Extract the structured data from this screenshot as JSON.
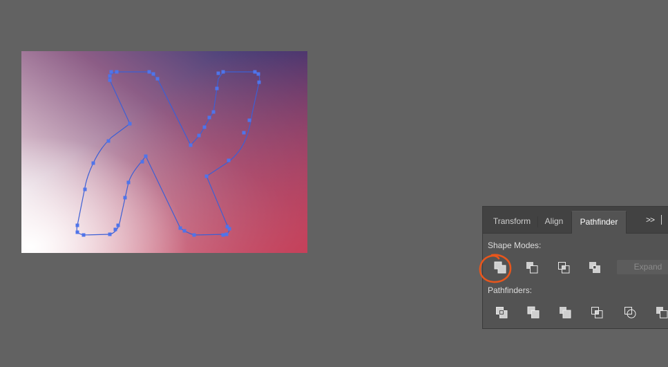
{
  "panel": {
    "tabs": [
      {
        "label": "Transform"
      },
      {
        "label": "Align"
      },
      {
        "label": "Pathfinder",
        "active": true
      }
    ],
    "overflow_label": ">>",
    "shape_modes_label": "Shape Modes:",
    "pathfinders_label": "Pathfinders:",
    "expand_label": "Expand",
    "shape_mode_buttons": [
      "unite-icon",
      "minus-front-icon",
      "intersect-icon",
      "exclude-icon"
    ],
    "pathfinder_buttons": [
      "divide-icon",
      "trim-icon",
      "merge-icon",
      "crop-icon",
      "outline-icon",
      "minus-back-icon"
    ]
  },
  "colors": {
    "background": "#626262",
    "panel": "#535353",
    "path_stroke": "#3d5fd4",
    "anchor": "#4f74ea",
    "highlight": "#e8561c",
    "gradient_white": "#ffffff",
    "gradient_pink": "#c7a4ba",
    "gradient_navy": "#2f3574",
    "gradient_red": "#c83d56"
  },
  "canvas": {
    "letter": "X"
  },
  "annotation": {
    "highlight_target": "unite-icon"
  }
}
